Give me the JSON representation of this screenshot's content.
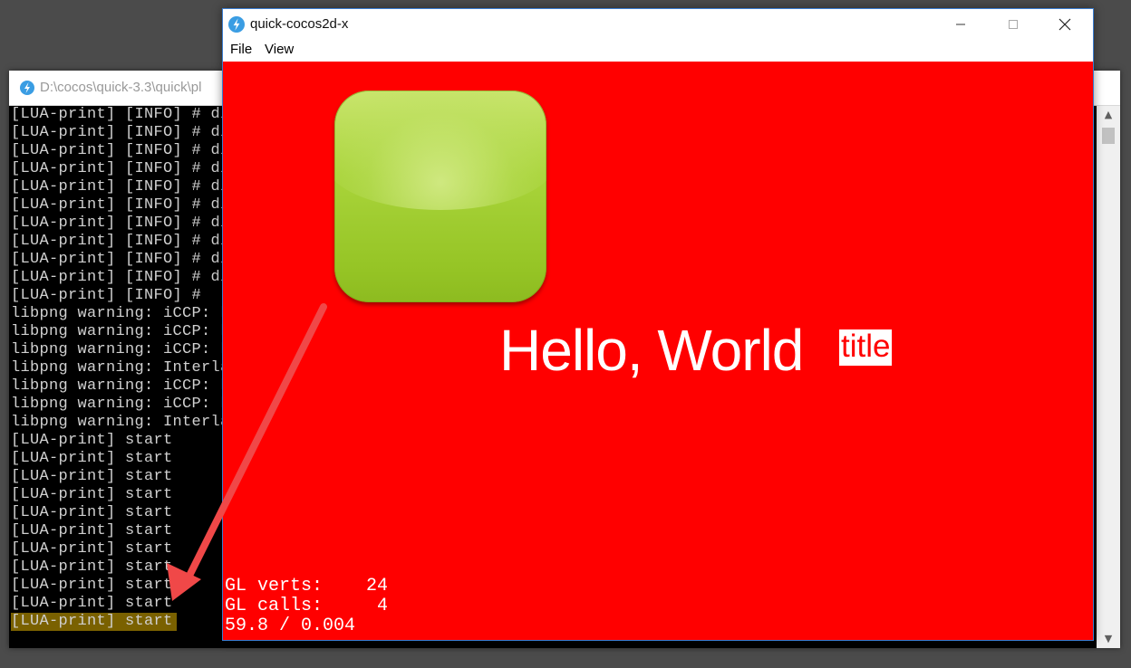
{
  "console": {
    "title": "D:\\cocos\\quick-3.3\\quick\\pl",
    "lines": [
      "[LUA-print] [INFO] # dis",
      "[LUA-print] [INFO] # dis",
      "[LUA-print] [INFO] # dis",
      "[LUA-print] [INFO] # dis",
      "[LUA-print] [INFO] # dis",
      "[LUA-print] [INFO] # dis",
      "[LUA-print] [INFO] # dis",
      "[LUA-print] [INFO] # dis",
      "[LUA-print] [INFO] # dis",
      "[LUA-print] [INFO] # dis",
      "[LUA-print] [INFO] #",
      "libpng warning: iCCP: kn",
      "libpng warning: iCCP: kn",
      "libpng warning: iCCP: kn",
      "libpng warning: Interlac",
      "libpng warning: iCCP: kn",
      "libpng warning: iCCP: kn",
      "libpng warning: Interlac",
      "[LUA-print] start",
      "[LUA-print] start",
      "[LUA-print] start",
      "[LUA-print] start",
      "[LUA-print] start",
      "[LUA-print] start",
      "[LUA-print] start",
      "[LUA-print] start",
      "[LUA-print] start",
      "[LUA-print] start"
    ],
    "highlighted_line": "[LUA-print] start",
    "scroll_up_glyph": "▲",
    "scroll_down_glyph": "▼"
  },
  "simulator": {
    "title": "quick-cocos2d-x",
    "menu": {
      "file": "File",
      "view": "View"
    },
    "canvas": {
      "background": "#ff0000",
      "hello_text": "Hello, World",
      "title_text": "title",
      "stats": {
        "line1": "GL verts:    24",
        "line2": "GL calls:     4",
        "line3": "59.8 / 0.004"
      }
    }
  },
  "colors": {
    "arrow": "#f04848",
    "console_highlight": "#7a6100",
    "button_green": "#a9d43a"
  }
}
